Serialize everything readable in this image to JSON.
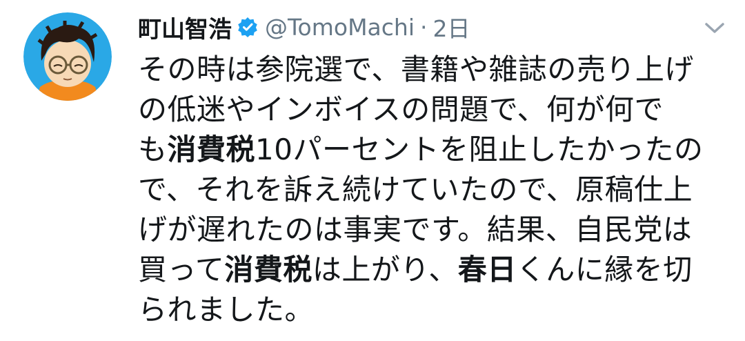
{
  "tweet": {
    "display_name": "町山智浩",
    "handle": "@TomoMachi",
    "separator": "·",
    "timestamp": "2日",
    "lines": [
      [
        {
          "t": "その時は参院選で、書籍や雑誌の売り上げ",
          "b": false
        }
      ],
      [
        {
          "t": "の低迷やインボイスの問題で、何が何で",
          "b": false
        }
      ],
      [
        {
          "t": "も",
          "b": false
        },
        {
          "t": "消費税",
          "b": true
        },
        {
          "t": "10パーセントを阻止したかったの",
          "b": false
        }
      ],
      [
        {
          "t": "で、それを訴え続けていたので、原稿仕上",
          "b": false
        }
      ],
      [
        {
          "t": "げが遅れたのは事実です。結果、自民党は",
          "b": false
        }
      ],
      [
        {
          "t": "買って",
          "b": false
        },
        {
          "t": "消費税",
          "b": true
        },
        {
          "t": "は上がり、",
          "b": false
        },
        {
          "t": "春日",
          "b": true
        },
        {
          "t": "くんに縁を切",
          "b": false
        }
      ],
      [
        {
          "t": "られました。",
          "b": false
        }
      ]
    ]
  },
  "icons": {
    "verified": "verified-badge-icon",
    "menu": "chevron-down-icon",
    "avatar": "avatar-illustration"
  },
  "colors": {
    "verified": "#1da1f2",
    "secondary_text": "#657786",
    "avatar_bg": "#2aa8e6"
  }
}
